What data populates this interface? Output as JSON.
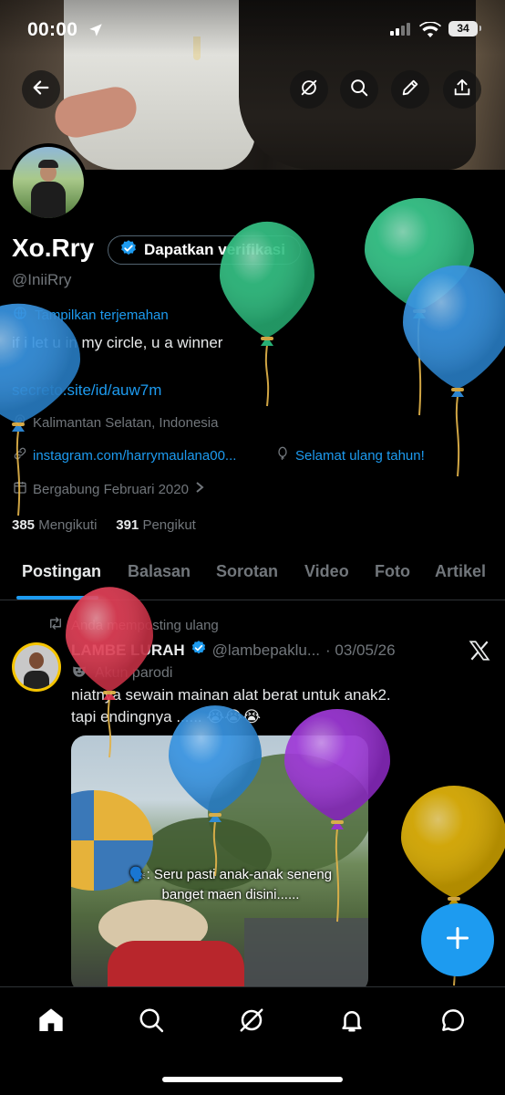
{
  "status_bar": {
    "time": "00:00",
    "battery": "34"
  },
  "profile": {
    "name": "Xo.Rry",
    "verify_label": "Dapatkan verifikasi",
    "handle": "@IniiRry",
    "translate_label": "Tampilkan terjemahan",
    "bio": "if i let u in my circle, u a winner",
    "bio_link": "secreto.site/id/auw7m",
    "location": "Kalimantan Selatan, Indonesia",
    "website": "instagram.com/harrymaulana00...",
    "birthday": "Selamat ulang tahun!",
    "joined": "Bergabung Februari 2020",
    "following_count": "385",
    "following_label": "Mengikuti",
    "followers_count": "391",
    "followers_label": "Pengikut"
  },
  "tabs": [
    "Postingan",
    "Balasan",
    "Sorotan",
    "Video",
    "Foto",
    "Artikel"
  ],
  "post": {
    "repost_label": "Anda memposting ulang",
    "author_name": "LAMBE LURAH",
    "author_handle": "@lambepaklu...",
    "date": "· 03/05/26",
    "parody_label": "Akun parodi",
    "text_line1": "niatnya sewain mainan alat berat untuk anak2.",
    "text_line2": "tapi endingnya ...... 😭😭😭",
    "media_caption_line1": "🗣️: Seru pasti anak-anak seneng",
    "media_caption_line2": "banget maen disini......"
  },
  "icons": {
    "back": "back-arrow-icon",
    "grok": "grok-icon",
    "search": "search-icon",
    "edit": "edit-icon",
    "share": "share-icon",
    "compose": "plus-icon"
  },
  "colors": {
    "accent": "#1d9bf0",
    "background": "#000000",
    "muted": "#71767b",
    "text": "#e7e9ea"
  },
  "balloon_colors": [
    "#2bbf7f",
    "#31c889",
    "#2f8fe0",
    "#2f8fe0",
    "#e1374f",
    "#2f8fe0",
    "#9a2fd6",
    "#e2b200"
  ]
}
